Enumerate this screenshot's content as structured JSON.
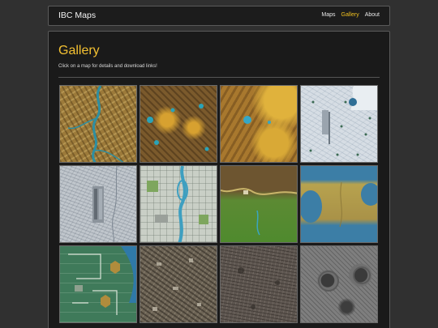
{
  "navbar": {
    "brand": "IBC Maps",
    "links": [
      {
        "label": "Maps",
        "active": false
      },
      {
        "label": "Gallery",
        "active": true
      },
      {
        "label": "About",
        "active": false
      }
    ]
  },
  "main": {
    "title": "Gallery",
    "subtitle": "Click on a map for details and download links!"
  },
  "gallery": {
    "thumbnails": [
      {
        "terrain": "desert-river"
      },
      {
        "terrain": "desert-lakes"
      },
      {
        "terrain": "desert-hex"
      },
      {
        "terrain": "snow-base"
      },
      {
        "terrain": "snow-city"
      },
      {
        "terrain": "city-river"
      },
      {
        "terrain": "grass-hills"
      },
      {
        "terrain": "coast"
      },
      {
        "terrain": "island-base"
      },
      {
        "terrain": "rubble"
      },
      {
        "terrain": "wasteland"
      },
      {
        "terrain": "craters"
      }
    ]
  },
  "colors": {
    "accent": "#f4c132",
    "navbar_bg": "#1c1c1c",
    "panel_bg": "#1a1a1a",
    "page_bg": "#303030"
  }
}
